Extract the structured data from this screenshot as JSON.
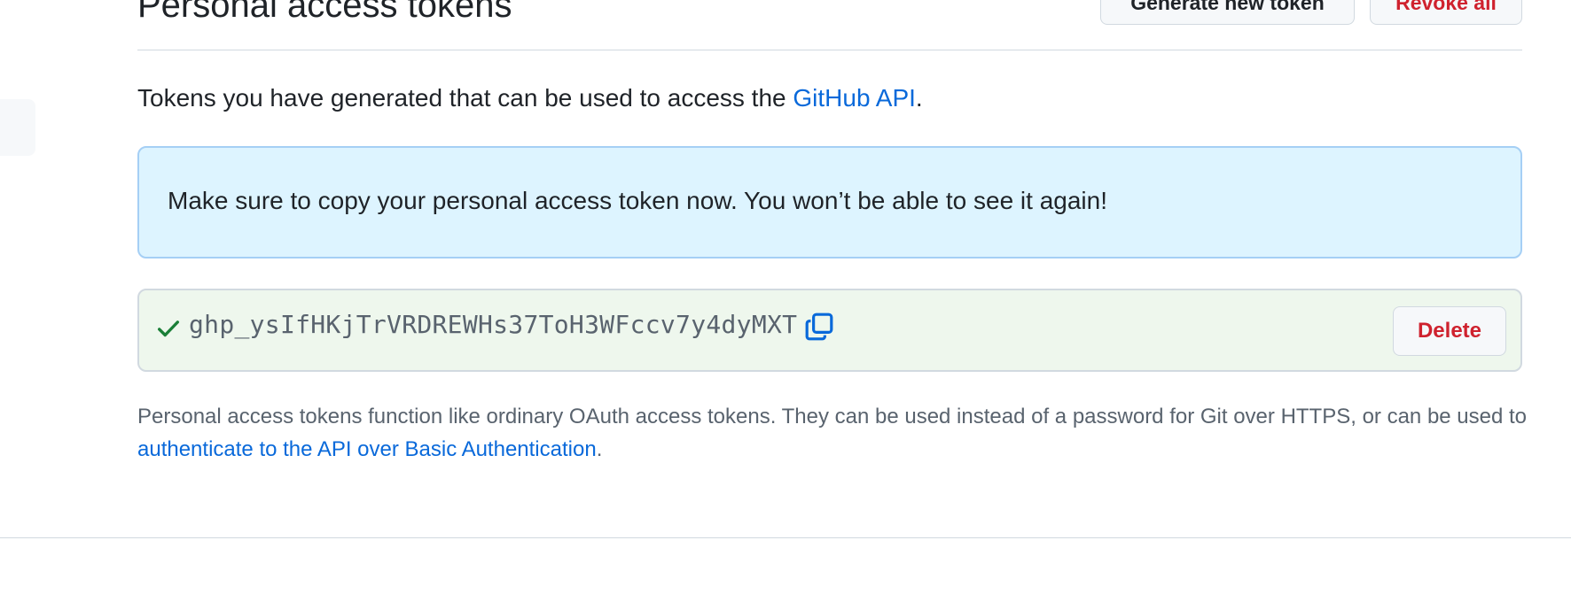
{
  "header": {
    "title": "Personal access tokens",
    "generate_button": "Generate new token",
    "revoke_button": "Revoke all"
  },
  "intro": {
    "text": "Tokens you have generated that can be used to access the ",
    "link": "GitHub API",
    "suffix": "."
  },
  "flash": {
    "message": "Make sure to copy your personal access token now. You won’t be able to see it again!"
  },
  "token": {
    "value": "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",
    "status_icon": "check-icon",
    "copy_icon": "copy-icon",
    "delete_label": "Delete"
  },
  "note": {
    "text": "Personal access tokens function like ordinary OAuth access tokens. They can be used instead of a password for Git over HTTPS, or can be used to ",
    "link": "authenticate to the API over Basic Authentication",
    "suffix": "."
  },
  "colors": {
    "link": "#0969da",
    "danger": "#cf222e",
    "flash_bg": "#ddf4ff",
    "token_bg": "#eef7ed",
    "success": "#1a7f37"
  }
}
